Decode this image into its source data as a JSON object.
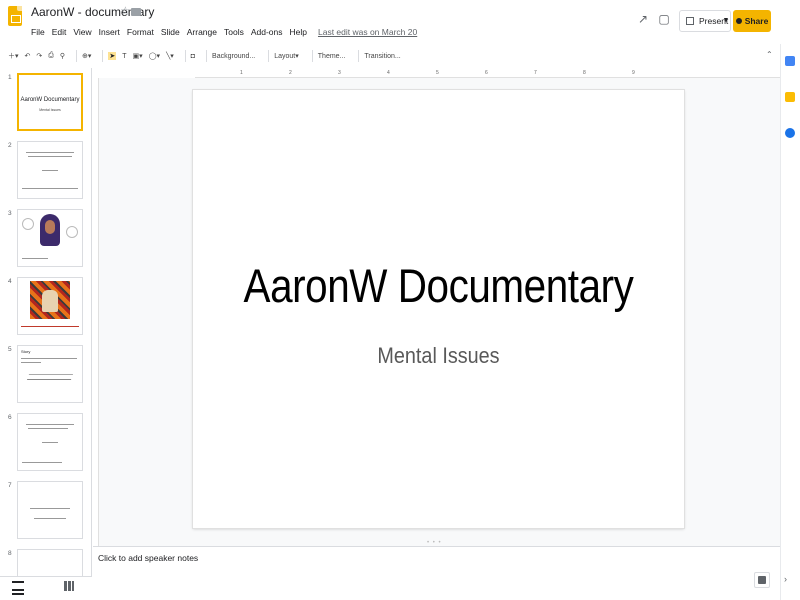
{
  "header": {
    "title": "AaronW - documentary",
    "menu": [
      "File",
      "Edit",
      "View",
      "Insert",
      "Format",
      "Slide",
      "Arrange",
      "Tools",
      "Add-ons",
      "Help"
    ],
    "last_edit": "Last edit was on March 20",
    "present_label": "Present",
    "share_label": "Share"
  },
  "toolbar": {
    "background_label": "Background...",
    "layout_label": "Layout",
    "theme_label": "Theme...",
    "transition_label": "Transition..."
  },
  "ruler": {
    "ticks": [
      "1",
      "2",
      "3",
      "4",
      "5",
      "6",
      "7",
      "8",
      "9"
    ]
  },
  "filmstrip": {
    "slides": [
      {
        "number": "1",
        "title": "AaronW Documentary",
        "subtitle": "Mental Issues",
        "selected": true
      },
      {
        "number": "2"
      },
      {
        "number": "3"
      },
      {
        "number": "4"
      },
      {
        "number": "5",
        "title": "Story"
      },
      {
        "number": "6"
      },
      {
        "number": "7"
      },
      {
        "number": "8"
      }
    ]
  },
  "slide": {
    "title": "AaronW Documentary",
    "subtitle": "Mental Issues"
  },
  "notes": {
    "placeholder": "Click to add speaker notes"
  },
  "colors": {
    "accent": "#f4b400",
    "canvas_bg": "#f8f9fa"
  }
}
